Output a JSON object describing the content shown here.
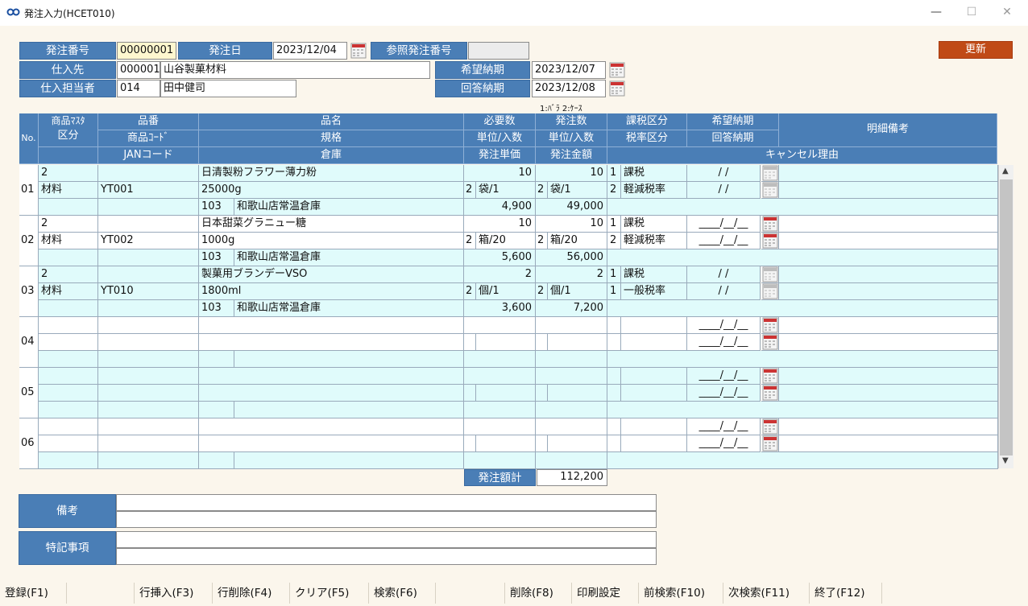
{
  "window": {
    "title": "発注入力(HCET010)"
  },
  "header": {
    "order_no_label": "発注番号",
    "order_no": "00000001",
    "order_date_label": "発注日",
    "order_date": "2023/12/04",
    "ref_no_label": "参照発注番号",
    "ref_no": "",
    "update_label": "更新",
    "supplier_label": "仕入先",
    "supplier_code": "000001",
    "supplier_name": "山谷製菓材料",
    "staff_label": "仕入担当者",
    "staff_code": "014",
    "staff_name": "田中健司",
    "desired_label": "希望納期",
    "desired_date": "2023/12/07",
    "reply_label": "回答納期",
    "reply_date": "2023/12/08",
    "unit_note": "1:ﾊﾞﾗ 2:ｹｰｽ"
  },
  "grid": {
    "headers": {
      "no": "No.",
      "master": "商品ﾏｽﾀ",
      "kbn": "区分",
      "hinban": "品番",
      "item_code": "商品ｺｰﾄﾞ",
      "jan": "JANコード",
      "hinmei": "品名",
      "spec": "規格",
      "warehouse": "倉庫",
      "req_qty": "必要数",
      "unit1": "単位/入数",
      "price": "発注単価",
      "order_qty": "発注数",
      "unit2": "単位/入数",
      "amount": "発注金額",
      "tax": "課税区分",
      "taxrate": "税率区分",
      "desired": "希望納期",
      "reply": "回答納期",
      "remarks": "明細備考",
      "cancel": "キャンセル理由"
    },
    "rows": [
      {
        "no": "01",
        "kbn_code": "2",
        "kbn": "材料",
        "hinban": "",
        "code": "YT001",
        "jan": "",
        "name": "日清製粉フラワー薄力粉",
        "spec": "25000g",
        "wh_code": "103",
        "wh_name": "和歌山店常温倉庫",
        "req_qty": "10",
        "u1_code": "2",
        "u1": "袋/1",
        "price": "4,900",
        "ord_qty": "10",
        "u2_code": "2",
        "u2": "袋/1",
        "amount": "49,000",
        "tax_code": "1",
        "tax": "課税",
        "rate_code": "2",
        "rate": "軽減税率",
        "desired": " /  /",
        "reply": " /  /",
        "cal_disabled": true
      },
      {
        "no": "02",
        "kbn_code": "2",
        "kbn": "材料",
        "hinban": "",
        "code": "YT002",
        "jan": "",
        "name": "日本甜菜グラニュー糖",
        "spec": "1000g",
        "wh_code": "103",
        "wh_name": "和歌山店常温倉庫",
        "req_qty": "10",
        "u1_code": "2",
        "u1": "箱/20",
        "price": "5,600",
        "ord_qty": "10",
        "u2_code": "2",
        "u2": "箱/20",
        "amount": "56,000",
        "tax_code": "1",
        "tax": "課税",
        "rate_code": "2",
        "rate": "軽減税率",
        "desired": "____/__/__",
        "reply": "____/__/__",
        "cal_disabled": false
      },
      {
        "no": "03",
        "kbn_code": "2",
        "kbn": "材料",
        "hinban": "",
        "code": "YT010",
        "jan": "",
        "name": "製菓用ブランデーVSO",
        "spec": "1800ml",
        "wh_code": "103",
        "wh_name": "和歌山店常温倉庫",
        "req_qty": "2",
        "u1_code": "2",
        "u1": "個/1",
        "price": "3,600",
        "ord_qty": "2",
        "u2_code": "2",
        "u2": "個/1",
        "amount": "7,200",
        "tax_code": "1",
        "tax": "課税",
        "rate_code": "1",
        "rate": "一般税率",
        "desired": " /  /",
        "reply": " /  /",
        "cal_disabled": true
      },
      {
        "no": "04",
        "kbn_code": "",
        "kbn": "",
        "hinban": "",
        "code": "",
        "jan": "",
        "name": "",
        "spec": "",
        "wh_code": "",
        "wh_name": "",
        "req_qty": "",
        "u1_code": "",
        "u1": "",
        "price": "",
        "ord_qty": "",
        "u2_code": "",
        "u2": "",
        "amount": "",
        "tax_code": "",
        "tax": "",
        "rate_code": "",
        "rate": "",
        "desired": "____/__/__",
        "reply": "____/__/__",
        "cal_disabled": false
      },
      {
        "no": "05",
        "kbn_code": "",
        "kbn": "",
        "hinban": "",
        "code": "",
        "jan": "",
        "name": "",
        "spec": "",
        "wh_code": "",
        "wh_name": "",
        "req_qty": "",
        "u1_code": "",
        "u1": "",
        "price": "",
        "ord_qty": "",
        "u2_code": "",
        "u2": "",
        "amount": "",
        "tax_code": "",
        "tax": "",
        "rate_code": "",
        "rate": "",
        "desired": "____/__/__",
        "reply": "____/__/__",
        "cal_disabled": false
      },
      {
        "no": "06",
        "kbn_code": "",
        "kbn": "",
        "hinban": "",
        "code": "",
        "jan": "",
        "name": "",
        "spec": "",
        "wh_code": "",
        "wh_name": "",
        "req_qty": "",
        "u1_code": "",
        "u1": "",
        "price": "",
        "ord_qty": "",
        "u2_code": "",
        "u2": "",
        "amount": "",
        "tax_code": "",
        "tax": "",
        "rate_code": "",
        "rate": "",
        "desired": "____/__/__",
        "reply": "____/__/__",
        "cal_disabled": false
      }
    ],
    "total_label": "発注額計",
    "total": "112,200"
  },
  "notes": {
    "biko_label": "備考",
    "tokki_label": "特記事項"
  },
  "fkeys": [
    {
      "label": "登録(F1)"
    },
    {
      "label": ""
    },
    {
      "label": "行挿入(F3)"
    },
    {
      "label": "行削除(F4)"
    },
    {
      "label": "クリア(F5)"
    },
    {
      "label": "検索(F6)"
    },
    {
      "label": ""
    },
    {
      "label": "削除(F8)"
    },
    {
      "label": "印刷設定"
    },
    {
      "label": "前検索(F10)"
    },
    {
      "label": "次検索(F11)"
    },
    {
      "label": "終了(F12)"
    }
  ],
  "colors": {
    "label_blue": "#4a7eb6",
    "row_cyan": "#e0fbfb",
    "update_orange": "#c04a16",
    "background": "#fbf6ec"
  }
}
